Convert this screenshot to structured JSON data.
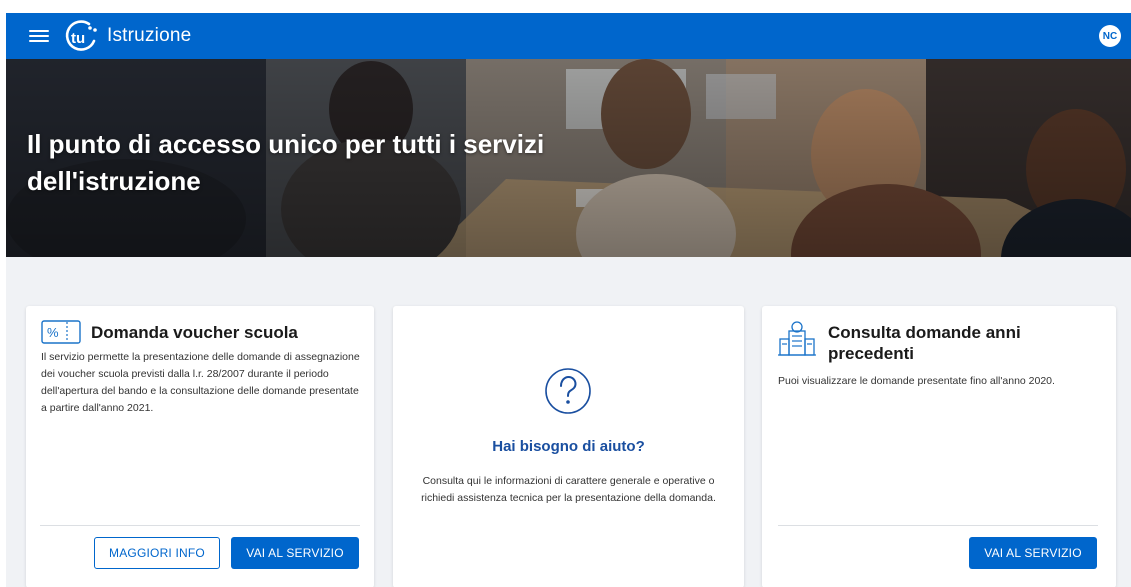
{
  "header": {
    "logo_text": "tu",
    "app_title": "Istruzione",
    "avatar_initials": "NC"
  },
  "hero": {
    "title": "Il punto di accesso unico per tutti i servizi dell'istruzione"
  },
  "cards": {
    "voucher": {
      "title": "Domanda voucher scuola",
      "icon": "percent-ticket-icon",
      "text": "Il servizio permette la presentazione delle domande di assegnazione dei voucher scuola previsti dalla l.r. 28/2007 durante il periodo dell'apertura del bando e la consultazione delle domande presentate a partire dall'anno 2021.",
      "more_info_label": "MAGGIORI INFO",
      "go_label": "VAI AL SERVIZIO"
    },
    "help": {
      "icon": "question-circle-icon",
      "title": "Hai bisogno di aiuto?",
      "text": "Consulta qui le informazioni di carattere generale e operative o richiedi assistenza tecnica per la presentazione della domanda."
    },
    "previous": {
      "title": "Consulta domande anni precedenti",
      "icon": "building-archive-icon",
      "text": "Puoi visualizzare le domande presentate fino all'anno 2020.",
      "go_label": "VAI AL SERVIZIO"
    }
  },
  "colors": {
    "primary": "#0066cc",
    "background": "#f0f2f5",
    "help_title": "#1a4fa0"
  }
}
